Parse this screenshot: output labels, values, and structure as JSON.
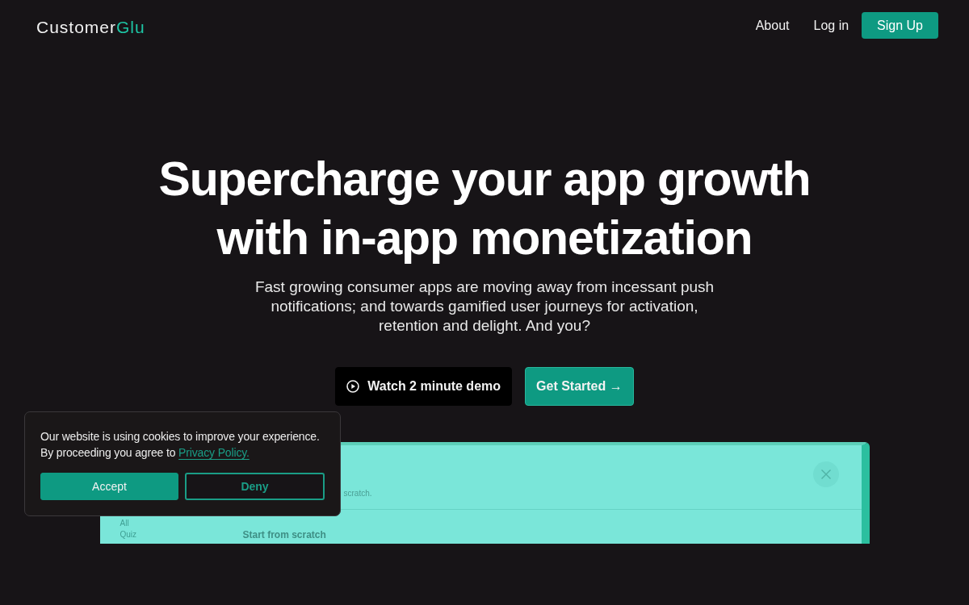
{
  "navbar": {
    "logo": {
      "primary": "Customer",
      "accent": "Glu"
    },
    "links": [
      "About",
      "Log in"
    ],
    "cta": "Sign Up"
  },
  "hero": {
    "headline_lines": [
      "Supercharge your app growth",
      "with in-app monetization"
    ],
    "subtitle": "Fast growing consumer apps are moving away from incessant push notifications; and towards gamified user journeys for activation, retention and delight. And you?",
    "buttons": [
      {
        "kind": "video",
        "label": "Watch 2 minute demo"
      },
      {
        "kind": "primary",
        "label": "Get Started →"
      }
    ]
  },
  "preview": {
    "subtitle_fragment": "scratch.",
    "sidebar_items": [
      "All",
      "Quiz"
    ],
    "section_title": "Start from scratch"
  },
  "cookie_banner": {
    "message": "Our website is using cookies to improve your experience. By proceeding you agree to",
    "link": "Privacy Policy.",
    "buttons": [
      {
        "kind": "accept",
        "label": "Accept"
      },
      {
        "kind": "deny",
        "label": "Deny"
      }
    ]
  }
}
